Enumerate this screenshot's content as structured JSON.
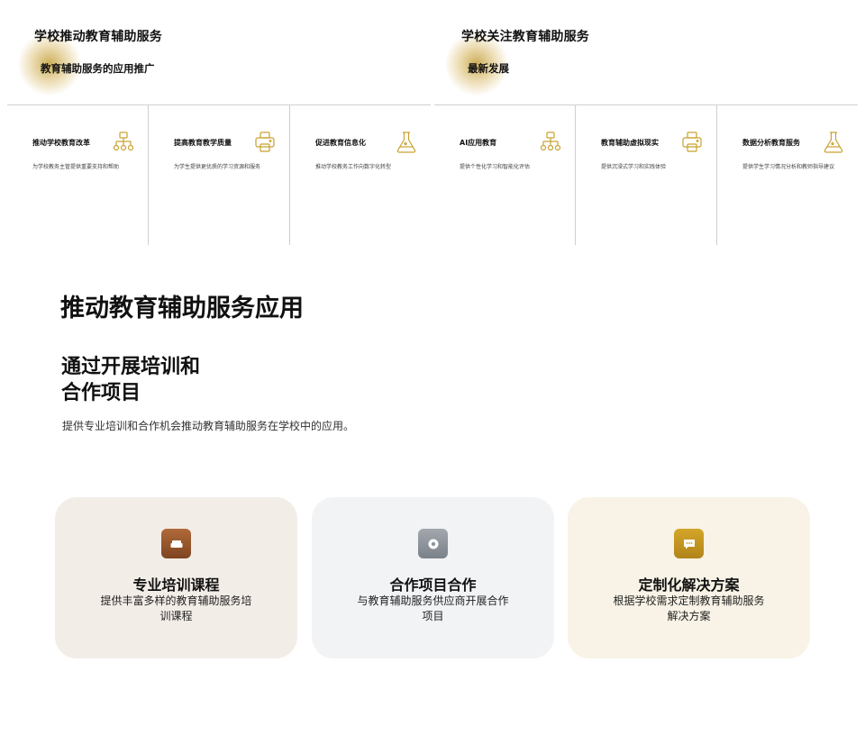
{
  "panels": [
    {
      "title": "学校推动教育辅助服务",
      "subtitle": "教育辅助服务的应用推广",
      "columns": [
        {
          "title": "推动学校教育改革",
          "desc": "为学校教务主管提供重要支持和帮助",
          "icon": "hierarchy-icon"
        },
        {
          "title": "提高教育教学质量",
          "desc": "为学生提供更优质的学习资源和服务",
          "icon": "printer-icon"
        },
        {
          "title": "促进教育信息化",
          "desc": "推动学校教务工作向数字化转型",
          "icon": "flask-icon"
        }
      ]
    },
    {
      "title": "学校关注教育辅助服务",
      "subtitle": "最新发展",
      "columns": [
        {
          "title": "AI应用教育",
          "desc": "提供个性化学习和智能化评估",
          "icon": "hierarchy-icon"
        },
        {
          "title": "教育辅助虚拟现实",
          "desc": "提供沉浸式学习和实践体验",
          "icon": "printer-icon"
        },
        {
          "title": "数据分析教育服务",
          "desc": "提供学生学习情况分析和教师指导建议",
          "icon": "flask-icon"
        }
      ]
    }
  ],
  "main": {
    "title": "推动教育辅助服务应用",
    "heading_line1": "通过开展培训和",
    "heading_line2": "合作项目",
    "description": "提供专业培训和合作机会推动教育辅助服务在学校中的应用。"
  },
  "cards": [
    {
      "title": "专业培训课程",
      "text": "提供丰富多样的教育辅助服务培训课程",
      "icon": "sofa-icon",
      "color": "#9a5a30"
    },
    {
      "title": "合作项目合作",
      "text": "与教育辅助服务供应商开展合作项目",
      "icon": "target-icon",
      "color": "#8f959c"
    },
    {
      "title": "定制化解决方案",
      "text": "根据学校需求定制教育辅助服务解决方案",
      "icon": "chat-icon",
      "color": "#c2961f"
    }
  ],
  "colors": {
    "accent_gold": "#c9a12e",
    "divider": "#cfcfcf"
  }
}
